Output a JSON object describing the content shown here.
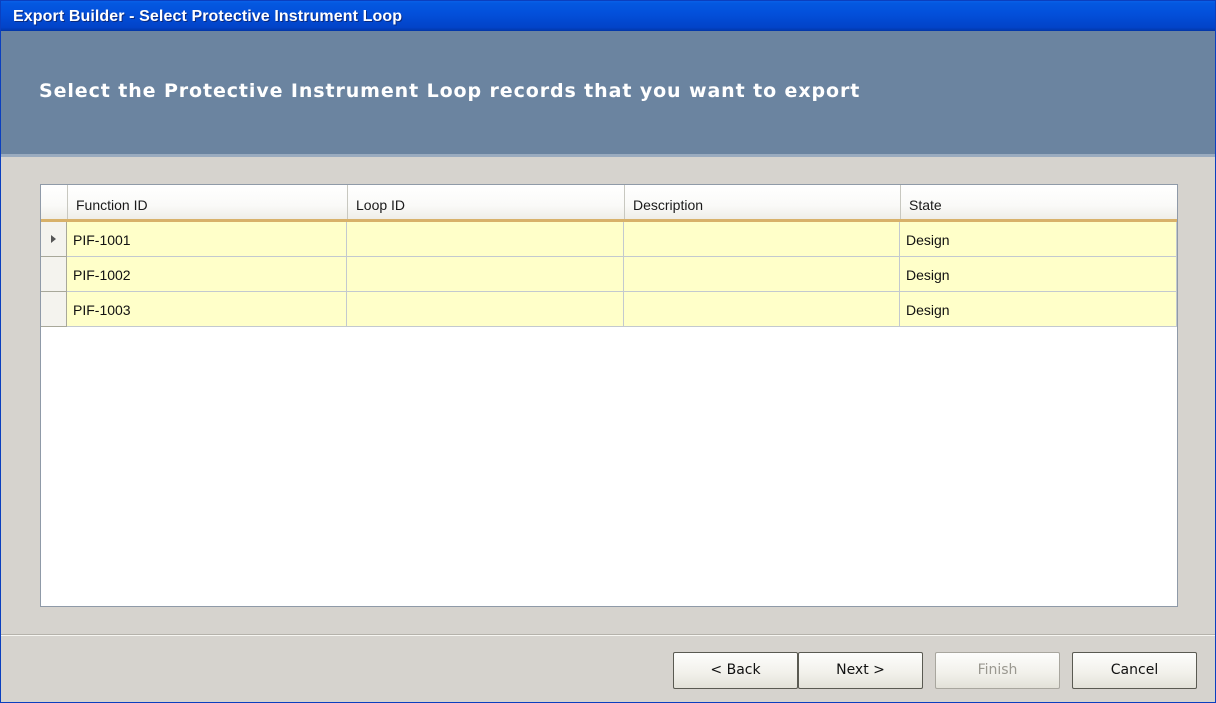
{
  "window": {
    "title": "Export Builder - Select Protective Instrument Loop"
  },
  "banner": {
    "heading": "Select the Protective Instrument Loop records that you want to export"
  },
  "grid": {
    "columns": [
      "Function ID",
      "Loop ID",
      "Description",
      "State"
    ],
    "rows": [
      {
        "function_id": "PIF-1001",
        "loop_id": "",
        "description": "",
        "state": "Design",
        "current": true
      },
      {
        "function_id": "PIF-1002",
        "loop_id": "",
        "description": "",
        "state": "Design",
        "current": false
      },
      {
        "function_id": "PIF-1003",
        "loop_id": "",
        "description": "",
        "state": "Design",
        "current": false
      }
    ]
  },
  "buttons": {
    "back": "< Back",
    "next": "Next >",
    "finish": "Finish",
    "cancel": "Cancel"
  },
  "colors": {
    "titlebar": "#0350db",
    "banner": "#6b84a0",
    "row_background": "#ffffc9",
    "header_underline": "#d8b16a"
  }
}
